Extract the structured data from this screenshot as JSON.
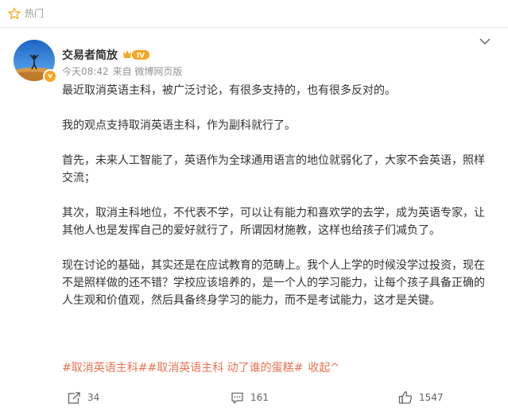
{
  "hot": {
    "label": "热门",
    "icon": "star-outline-icon"
  },
  "post": {
    "author": {
      "name": "交易者简放",
      "level_badge": "IV",
      "verified_icon": "verified-v-icon"
    },
    "meta": {
      "time": "今天08:42",
      "source": "来自 微博网页版"
    },
    "paragraphs": [
      "最近取消英语主科，被广泛讨论，有很多支持的，也有很多反对的。",
      "我的观点支持取消英语主科，作为副科就行了。",
      "首先，未来人工智能了，英语作为全球通用语言的地位就弱化了，大家不会英语，照样交流；",
      "其次，取消主科地位，不代表不学，可以让有能力和喜欢学的去学，成为英语专家，让其他人也是发挥自己的爱好就行了，所谓因材施教，这样也给孩子们减负了。",
      "现在讨论的基础，其实还是在应试教育的范畴上。我个人上学的时候没学过投资，现在不是照样做的还不错？学校应该培养的，是一个人的学习能力，让每个孩子具备正确的人生观和价值观，然后具备终身学习的能力，而不是考试能力，这才是关键。"
    ],
    "tags": [
      "#取消英语主科#",
      "#取消英语主科 动了谁的蛋糕#"
    ],
    "collapse_label": "收起^",
    "actions": {
      "repost_count": "34",
      "comment_count": "161",
      "like_count": "1547"
    }
  },
  "colors": {
    "accent": "#eb7350",
    "text": "#333333",
    "meta": "#939393",
    "badge_gold": "#f5a623"
  }
}
